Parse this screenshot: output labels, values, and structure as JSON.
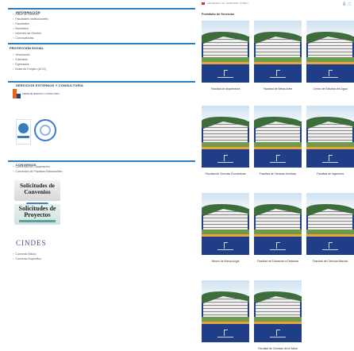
{
  "left": {
    "informacion": {
      "heading": "INFORMACIÓN",
      "items": [
        "Datos de Contexto",
        "Facultades Institucionales",
        "Facultades",
        "Normativa",
        "Informes de Gestión",
        "Convocatorias"
      ]
    },
    "proyeccion": {
      "heading": "PROYECCIÓN SOCIAL",
      "items": [
        "Vinculación",
        "Extensión",
        "Egresados",
        "Bolsa de Empleo (UCO)"
      ]
    },
    "servicios": {
      "heading": "SERVICIOS EXTERNOS Y CONSULTORÍA",
      "logo_text": "UNIDAD DE SERVICIOS Y CONSULTORÍA"
    },
    "convenios": {
      "heading": "CONVENIOS",
      "items": [
        "Convenios de Cooperación",
        "Convenios de Prácticas Estudiantiles"
      ],
      "btn1_big": "Solicitudes de Convenios",
      "btn1_small": "Descargue Aquí",
      "btn2_big": "Solicitudes de Proyectos",
      "cindes": "CINDES",
      "items2": [
        "Convenio Marco",
        "Convenio Específico"
      ]
    }
  },
  "right": {
    "updated": "Actualizado: Lun, 13/01/2015 - 2:59pm",
    "icons": [
      "print-icon",
      "pdf-icon"
    ],
    "portfolio_title": "Portafolio de Servicios",
    "cards": [
      {
        "label": "Facultad de Arquitectura"
      },
      {
        "label": "Facultad de Bellas Artes"
      },
      {
        "label": "Centro de Estudios del Agua"
      },
      {
        "label": "Facultad de Ciencias Económicas"
      },
      {
        "label": "Facultad de Ciencias Jurídicas"
      },
      {
        "label": "Facultad de Ingeniería"
      },
      {
        "label": "Museo de Antropología"
      },
      {
        "label": "Facultad de Educación a Distancia"
      },
      {
        "label": "Facultad de Ciencias Básicas"
      },
      {
        "label": ""
      },
      {
        "label": "Facultad de Ciencias de la Salud"
      }
    ]
  }
}
